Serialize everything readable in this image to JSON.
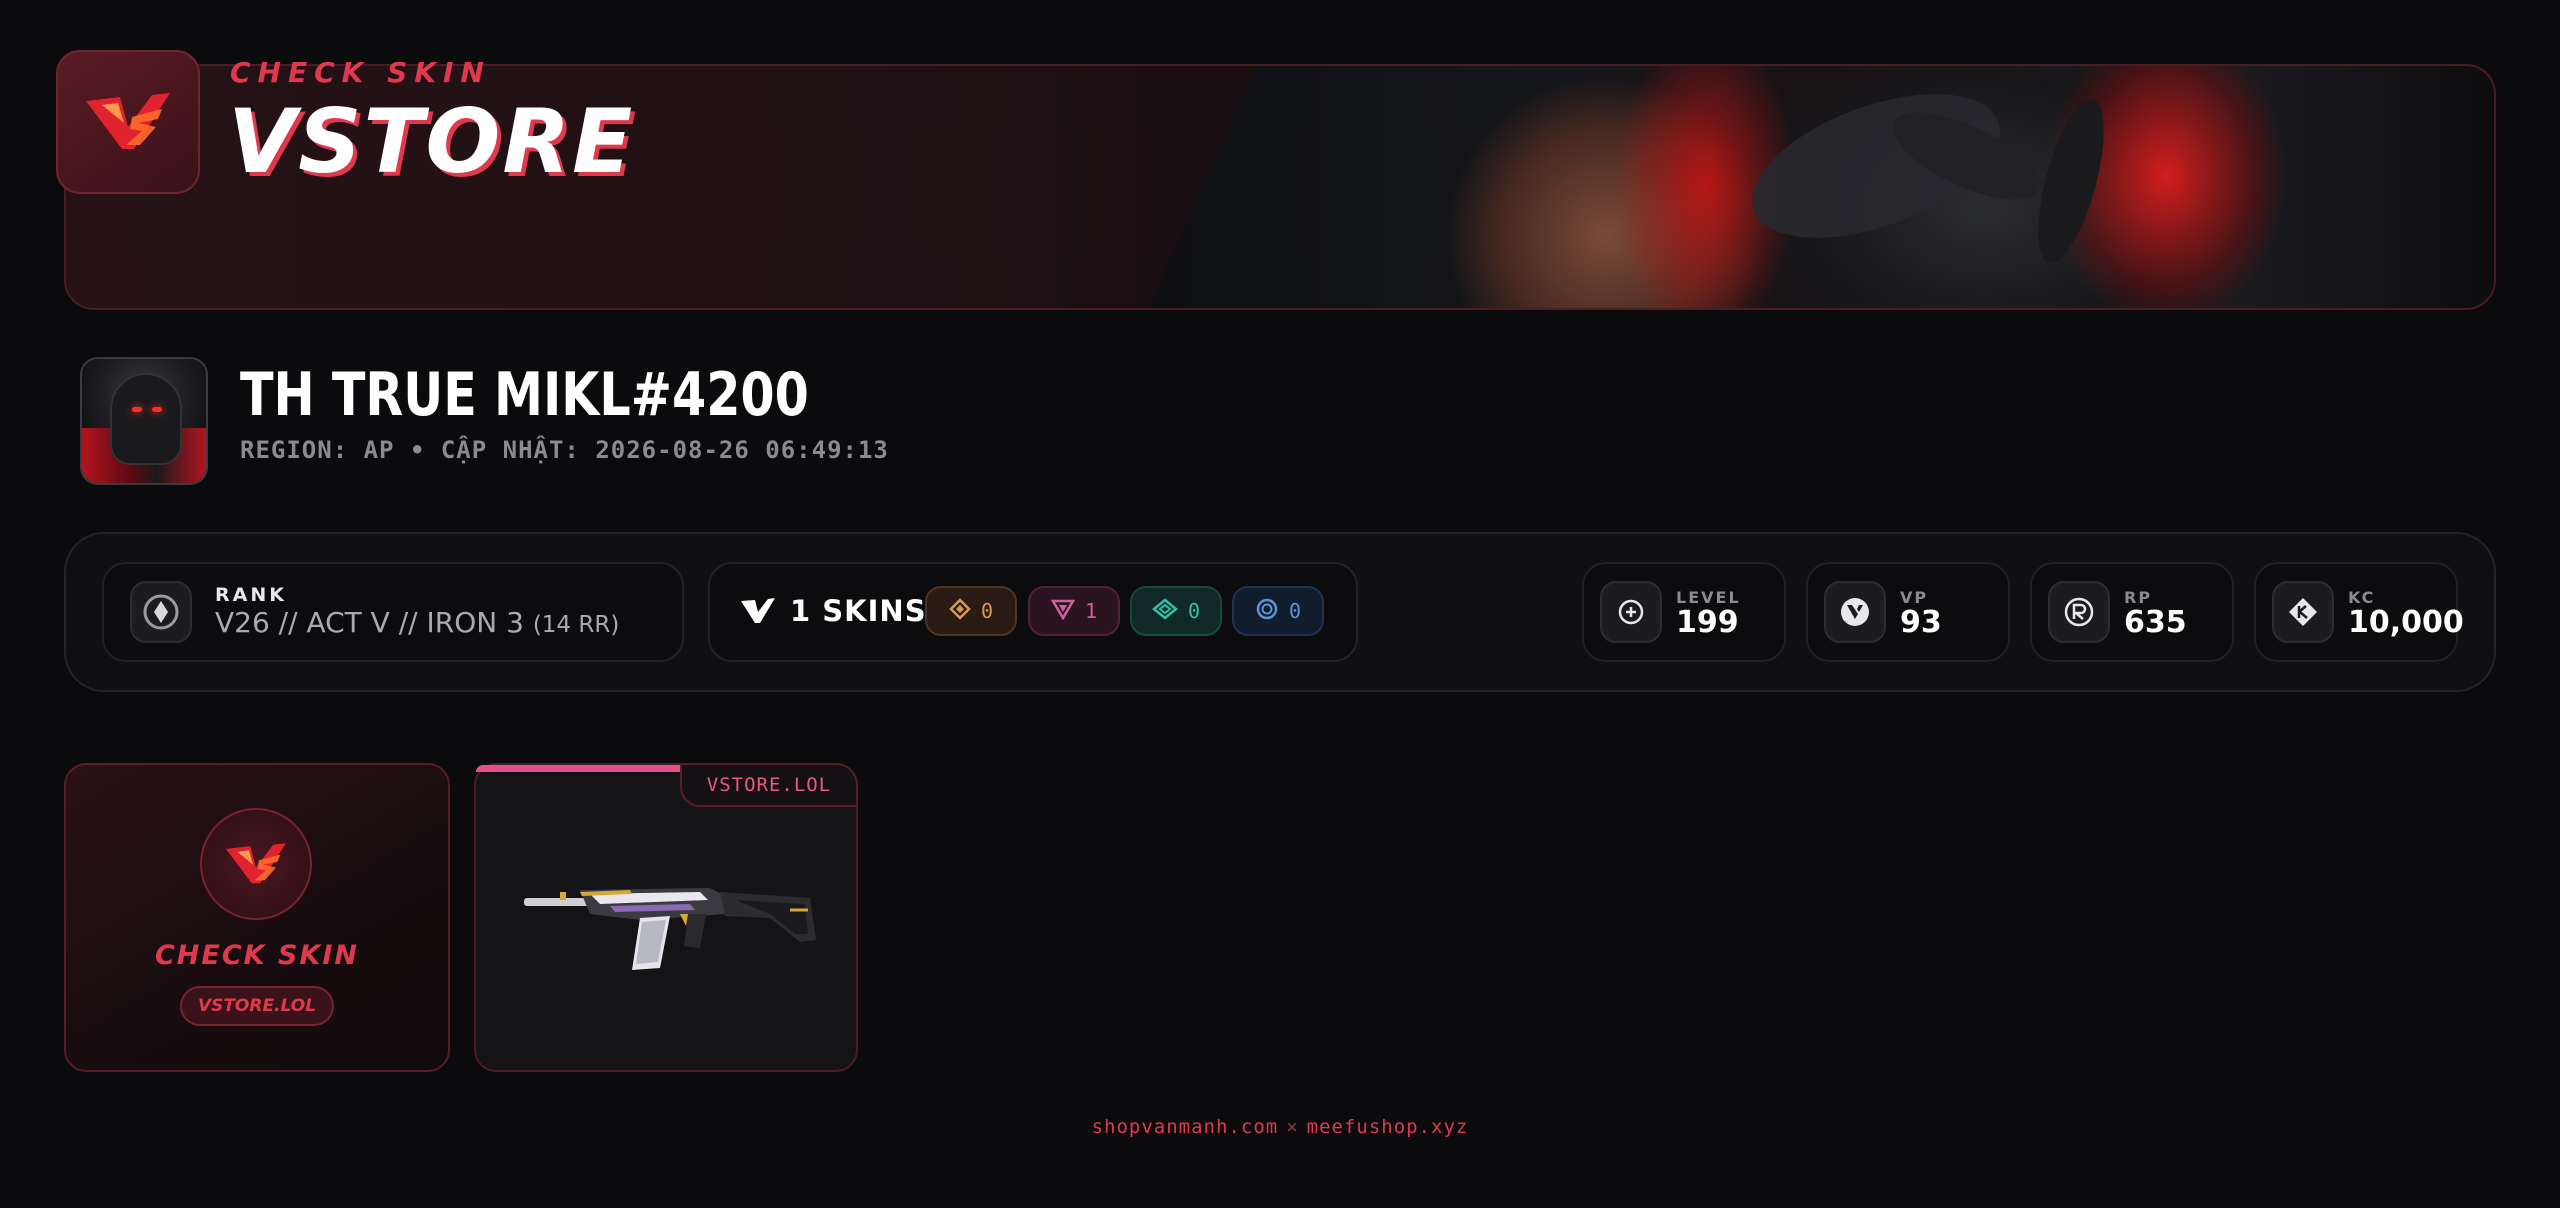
{
  "banner": {
    "subtitle": "CHECK SKIN",
    "title": "VSTORE"
  },
  "profile": {
    "name": "TH TRUE MIKL#4200",
    "meta": "REGION: AP • CẬP NHẬT: 2026-08-26 06:49:13"
  },
  "rank": {
    "label": "RANK",
    "value": "V26 // ACT V // IRON 3",
    "rr": "(14 RR)"
  },
  "skins": {
    "count_label": "1 SKINS",
    "tiers": [
      {
        "icon": "diamond-icon",
        "count": "0",
        "color": "#d99a4c"
      },
      {
        "icon": "triangle-icon",
        "count": "1",
        "color": "#d0609c"
      },
      {
        "icon": "rhombus-icon",
        "count": "0",
        "color": "#2fc2a6"
      },
      {
        "icon": "ring-icon",
        "count": "0",
        "color": "#5a95d6"
      }
    ]
  },
  "currencies": [
    {
      "label": "LEVEL",
      "value": "199",
      "icon": "level-plus-icon"
    },
    {
      "label": "VP",
      "value": "93",
      "icon": "valorant-points-icon"
    },
    {
      "label": "RP",
      "value": "635",
      "icon": "radianite-icon"
    },
    {
      "label": "KC",
      "value": "10,000",
      "icon": "kingdom-credits-icon"
    }
  ],
  "cards": {
    "promo_title": "CHECK SKIN",
    "promo_tag": "VSTORE.LOL",
    "skin_tag": "VSTORE.LOL"
  },
  "footer": {
    "left": "shopvanmanh.com",
    "sep": "×",
    "right": "meefushop.xyz"
  },
  "colors": {
    "accent": "#e0394d",
    "background": "#0b0b0d"
  }
}
